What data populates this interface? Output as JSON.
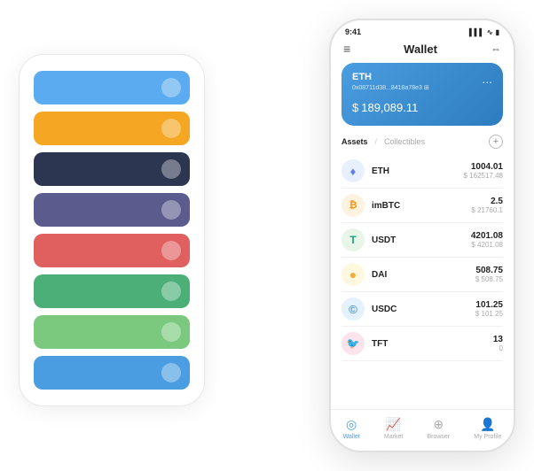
{
  "app": {
    "title": "Wallet"
  },
  "status_bar": {
    "time": "9:41",
    "signal": "▌▌▌",
    "wifi": "wifi",
    "battery": "battery"
  },
  "header": {
    "menu_icon": "≡",
    "title": "Wallet",
    "expand_icon": "⇔"
  },
  "eth_card": {
    "coin": "ETH",
    "address": "0x08711d38...8418a78e3",
    "address_suffix": "⊞",
    "balance_prefix": "$",
    "balance": "189,089.11",
    "dots": "..."
  },
  "assets_section": {
    "active_tab": "Assets",
    "inactive_tab": "Collectibles",
    "slash": "/",
    "add_icon": "+"
  },
  "assets": [
    {
      "icon": "♦",
      "icon_color": "#627eea",
      "bg": "eth-bg",
      "name": "ETH",
      "amount": "1004.01",
      "usd": "$ 162517.48"
    },
    {
      "icon": "₿",
      "icon_color": "#f7931a",
      "bg": "imbtc-bg",
      "name": "imBTC",
      "amount": "2.5",
      "usd": "$ 21760.1"
    },
    {
      "icon": "T",
      "icon_color": "#26a17b",
      "bg": "usdt-bg",
      "name": "USDT",
      "amount": "4201.08",
      "usd": "$ 4201.08"
    },
    {
      "icon": "◈",
      "icon_color": "#f5ac37",
      "bg": "dai-bg",
      "name": "DAI",
      "amount": "508.75",
      "usd": "$ 508.75"
    },
    {
      "icon": "©",
      "icon_color": "#2775ca",
      "bg": "usdc-bg",
      "name": "USDC",
      "amount": "101.25",
      "usd": "$ 101.25"
    },
    {
      "icon": "🐦",
      "icon_color": "#e91e63",
      "bg": "tft-bg",
      "name": "TFT",
      "amount": "13",
      "usd": "0"
    }
  ],
  "bottom_nav": [
    {
      "icon": "◎",
      "label": "Wallet",
      "active": true
    },
    {
      "icon": "📈",
      "label": "Market",
      "active": false
    },
    {
      "icon": "⊕",
      "label": "Browser",
      "active": false
    },
    {
      "icon": "👤",
      "label": "My Profile",
      "active": false
    }
  ],
  "card_stack": [
    {
      "color": "card-blue"
    },
    {
      "color": "card-orange"
    },
    {
      "color": "card-dark"
    },
    {
      "color": "card-purple"
    },
    {
      "color": "card-red"
    },
    {
      "color": "card-green"
    },
    {
      "color": "card-lightgreen"
    },
    {
      "color": "card-bluealt"
    }
  ]
}
